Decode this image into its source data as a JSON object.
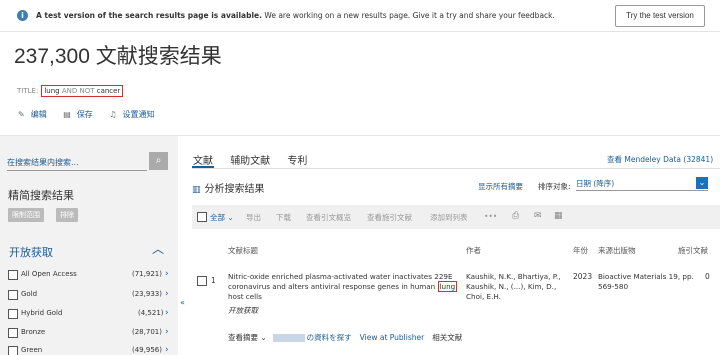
{
  "banner": {
    "icon": "info-icon",
    "bold": "A test version of the search results page is available.",
    "text": " We are working on a new results page. Give it a try and share your feedback.",
    "button": "Try the test version"
  },
  "header": {
    "result_count": "237,300 文献搜索结果",
    "query_field": "TITLE:",
    "query_term1": "lung",
    "query_op": "AND NOT",
    "query_term2": "cancer",
    "actions": [
      "编辑",
      "保存",
      "设置通知"
    ]
  },
  "sidebar": {
    "search_placeholder": "在搜索结果内搜索...",
    "refine_title": "精简搜索结果",
    "chips": [
      "限制范围",
      "排除"
    ],
    "open_access_title": "开放获取",
    "items": [
      {
        "label": "All Open Access",
        "count": "(71,921)"
      },
      {
        "label": "Gold",
        "count": "(23,933)"
      },
      {
        "label": "Hybrid Gold",
        "count": "(4,521)"
      },
      {
        "label": "Bronze",
        "count": "(28,701)"
      },
      {
        "label": "Green",
        "count": "(49,956)"
      }
    ]
  },
  "tabs": [
    "文献",
    "辅助文献",
    "专利"
  ],
  "mendeley": "查看 Mendeley Data (32841)",
  "analyze": "分析搜索结果",
  "show_abstracts": "显示所有摘要",
  "sort": {
    "label": "排序对象:",
    "value": "日期 (降序)"
  },
  "toolbar": {
    "all": "全部",
    "items": [
      "导出",
      "下载",
      "查看引文概览",
      "查看施引文献",
      "添加到列表",
      "•••"
    ]
  },
  "columns": [
    "文献标题",
    "作者",
    "年份",
    "来源出版物",
    "施引文献"
  ],
  "results": [
    {
      "num": "1",
      "title_pre": "Nitric-oxide enriched plasma-activated water inactivates 229E coronavirus and alters antiviral response genes in human ",
      "title_hl": "lung",
      "title_post": " host cells",
      "oa": "开放获取",
      "authors": "Kaushik, N.K., Bhartiya, P., Kaushik, N., (...), Kim, D., Choi, E.H.",
      "year": "2023",
      "source": "Bioactive Materials 19, pp. 569-580",
      "cites": "0",
      "links": {
        "abstract": "查看摘要",
        "find": "の資料を探す",
        "publisher": "View at Publisher",
        "related": "相关文献"
      }
    }
  ]
}
